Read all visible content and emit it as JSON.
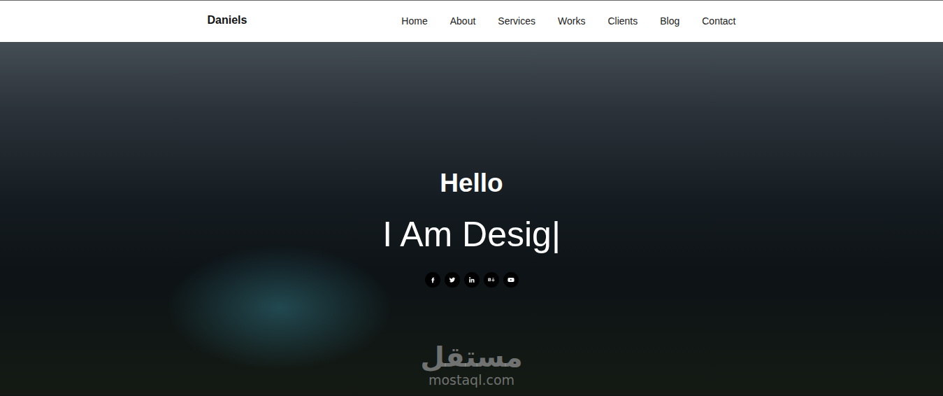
{
  "brand": "Daniels",
  "nav": [
    {
      "label": "Home"
    },
    {
      "label": "About"
    },
    {
      "label": "Services"
    },
    {
      "label": "Works"
    },
    {
      "label": "Clients"
    },
    {
      "label": "Blog"
    },
    {
      "label": "Contact"
    }
  ],
  "hero": {
    "greeting": "Hello",
    "typed": "I Am Desig",
    "cursor": "|"
  },
  "socials": [
    {
      "kind": "facebook"
    },
    {
      "kind": "twitter"
    },
    {
      "kind": "linkedin"
    },
    {
      "kind": "behance"
    },
    {
      "kind": "youtube"
    }
  ],
  "watermark": {
    "arabic": "مستقل",
    "latin": "mostaql.com"
  }
}
